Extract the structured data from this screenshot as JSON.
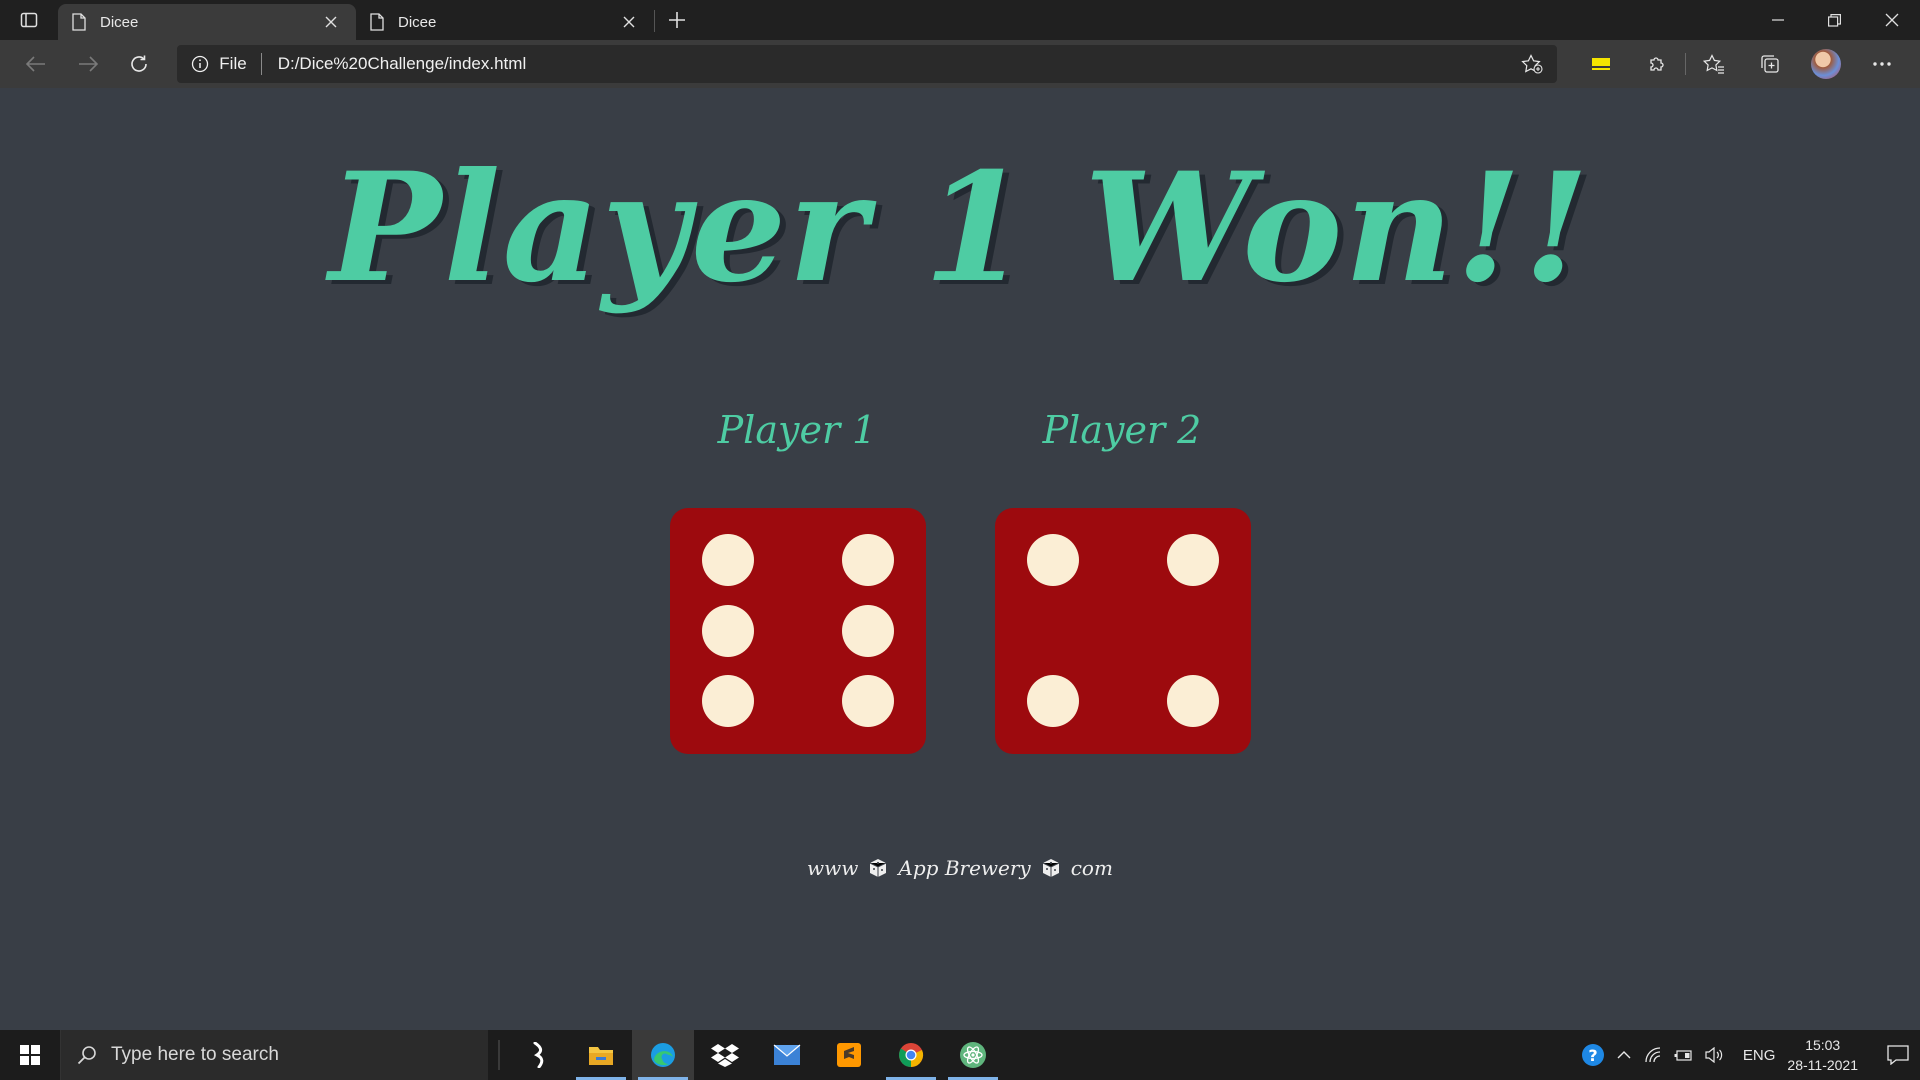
{
  "browser": {
    "tabs": [
      {
        "title": "Dicee",
        "active": true
      },
      {
        "title": "Dicee",
        "active": false
      }
    ],
    "address": {
      "scheme_label": "File",
      "url": "D:/Dice%20Challenge/index.html"
    }
  },
  "page": {
    "headline": "Player 1 Won!!",
    "players": [
      {
        "label": "Player 1",
        "dice_value": 6
      },
      {
        "label": "Player 2",
        "dice_value": 4
      }
    ],
    "footer": {
      "part1": "www",
      "part2": "App Brewery",
      "part3": "com"
    },
    "colors": {
      "background": "#393e46",
      "accent": "#4ecca3",
      "dice": "#9d0a0e",
      "pip": "#fbeed5"
    }
  },
  "taskbar": {
    "search_placeholder": "Type here to search",
    "apps": [
      "sublime-merge-icon",
      "file-explorer-icon",
      "edge-icon",
      "dropbox-icon",
      "mail-icon",
      "sublime-text-icon",
      "chrome-icon",
      "atom-icon"
    ],
    "language": "ENG",
    "time": "15:03",
    "date": "28-11-2021"
  }
}
